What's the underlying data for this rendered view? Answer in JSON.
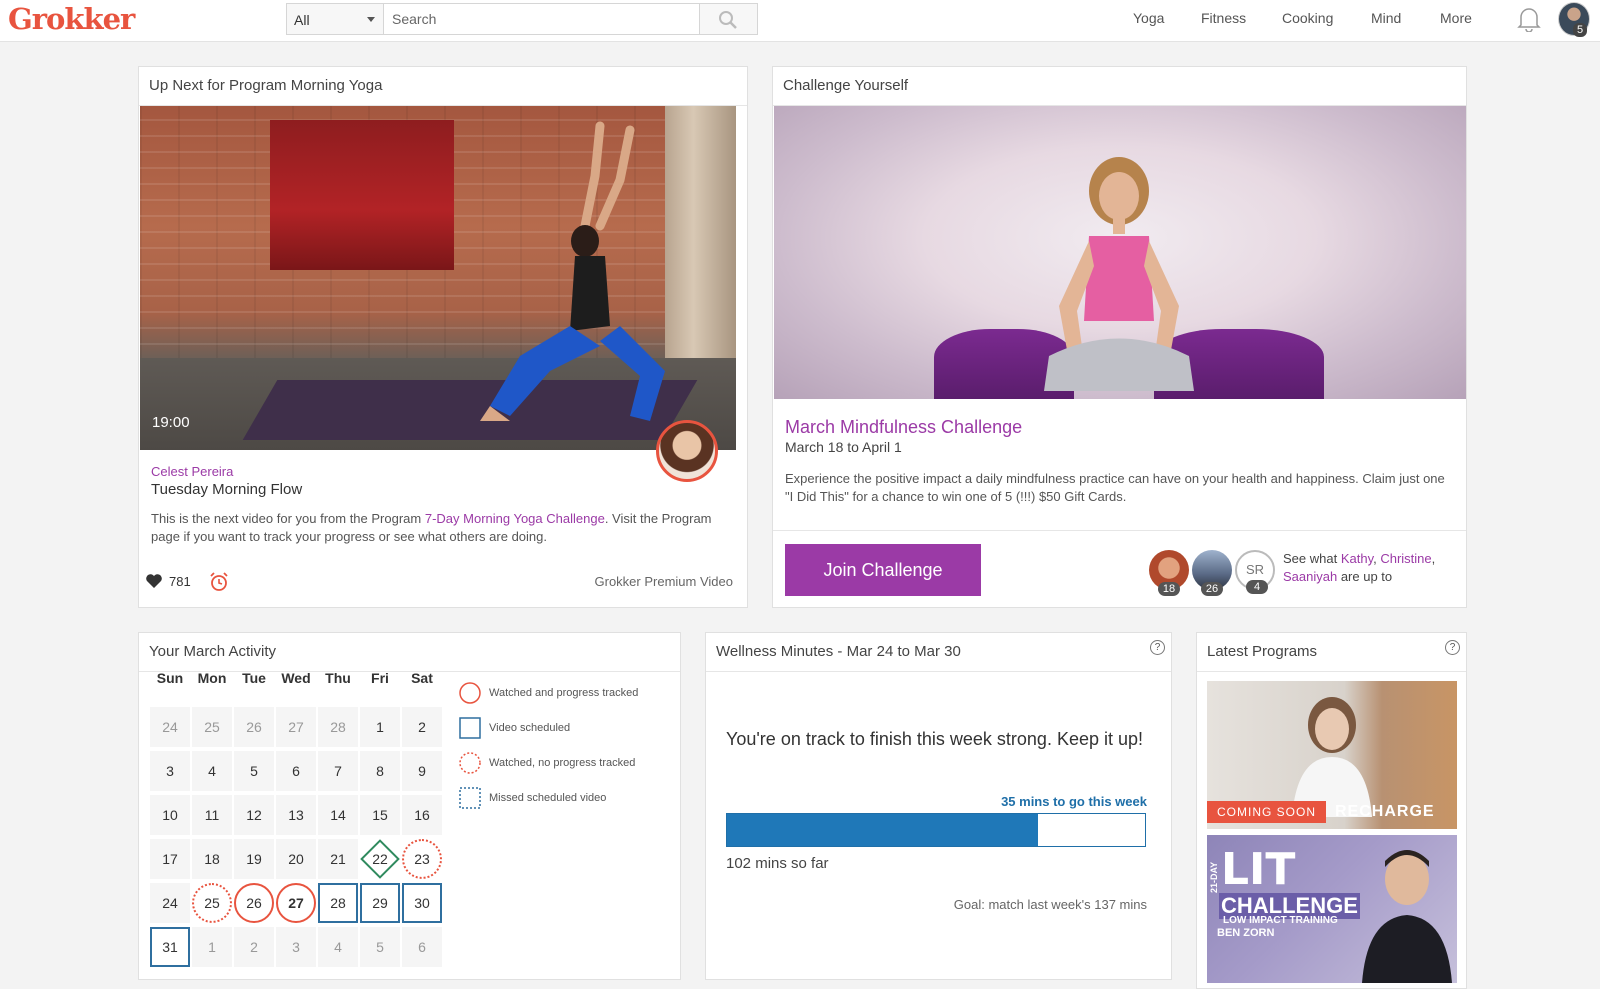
{
  "header": {
    "logo": "Grokker",
    "search_scope": "All",
    "search_placeholder": "Search",
    "nav": [
      "Yoga",
      "Fitness",
      "Cooking",
      "Mind",
      "More"
    ],
    "notification_count": "5"
  },
  "up_next": {
    "title": "Up Next for Program Morning Yoga",
    "duration": "19:00",
    "instructor": "Celest Pereira",
    "video_title": "Tuesday Morning Flow",
    "desc_before": "This is the next video for you from the Program ",
    "desc_link": "7-Day Morning Yoga Challenge",
    "desc_after": ". Visit the Program page if you want to track your progress or see what others are doing.",
    "likes": "781",
    "badge": "Grokker Premium Video"
  },
  "challenge": {
    "title": "Challenge Yourself",
    "name": "March Mindfulness Challenge",
    "dates": "March 18 to April 1",
    "description": "Experience the positive impact a daily mindfulness practice can have on your health and happiness. Claim just one \"I Did This\" for a chance to win one of 5 (!!!) $50 Gift Cards.",
    "join_label": "Join Challenge",
    "friends": [
      {
        "count": "18"
      },
      {
        "count": "26"
      },
      {
        "initials": "SR",
        "count": "4"
      }
    ],
    "see_what": "See what ",
    "friend_names": [
      "Kathy",
      "Christine",
      "Saaniyah"
    ],
    "are_up_to": " are up to",
    "comma": ", "
  },
  "activity": {
    "title": "Your March Activity",
    "days": [
      "Sun",
      "Mon",
      "Tue",
      "Wed",
      "Thu",
      "Fri",
      "Sat"
    ],
    "weeks": [
      [
        {
          "d": "24",
          "s": "other"
        },
        {
          "d": "25",
          "s": "other"
        },
        {
          "d": "26",
          "s": "other"
        },
        {
          "d": "27",
          "s": "other"
        },
        {
          "d": "28",
          "s": "other"
        },
        {
          "d": "1",
          "s": ""
        },
        {
          "d": "2",
          "s": ""
        }
      ],
      [
        {
          "d": "3",
          "s": ""
        },
        {
          "d": "4",
          "s": ""
        },
        {
          "d": "5",
          "s": ""
        },
        {
          "d": "6",
          "s": ""
        },
        {
          "d": "7",
          "s": ""
        },
        {
          "d": "8",
          "s": ""
        },
        {
          "d": "9",
          "s": ""
        }
      ],
      [
        {
          "d": "10",
          "s": ""
        },
        {
          "d": "11",
          "s": ""
        },
        {
          "d": "12",
          "s": ""
        },
        {
          "d": "13",
          "s": ""
        },
        {
          "d": "14",
          "s": ""
        },
        {
          "d": "15",
          "s": ""
        },
        {
          "d": "16",
          "s": ""
        }
      ],
      [
        {
          "d": "17",
          "s": ""
        },
        {
          "d": "18",
          "s": ""
        },
        {
          "d": "19",
          "s": ""
        },
        {
          "d": "20",
          "s": ""
        },
        {
          "d": "21",
          "s": ""
        },
        {
          "d": "22",
          "s": "diamond"
        },
        {
          "d": "23",
          "s": "dotted"
        }
      ],
      [
        {
          "d": "24",
          "s": ""
        },
        {
          "d": "25",
          "s": "dotted"
        },
        {
          "d": "26",
          "s": "watched"
        },
        {
          "d": "27",
          "s": "watched today"
        },
        {
          "d": "28",
          "s": "scheduled"
        },
        {
          "d": "29",
          "s": "scheduled"
        },
        {
          "d": "30",
          "s": "scheduled"
        }
      ],
      [
        {
          "d": "31",
          "s": "scheduled"
        },
        {
          "d": "1",
          "s": "other"
        },
        {
          "d": "2",
          "s": "other"
        },
        {
          "d": "3",
          "s": "other"
        },
        {
          "d": "4",
          "s": "other"
        },
        {
          "d": "5",
          "s": "other"
        },
        {
          "d": "6",
          "s": "other"
        }
      ]
    ],
    "legend": [
      "Watched and progress tracked",
      "Video scheduled",
      "Watched, no progress tracked",
      "Missed scheduled video"
    ]
  },
  "wellness": {
    "title": "Wellness Minutes - Mar 24 to Mar 30",
    "message": "You're on track to finish this week strong. Keep it up!",
    "to_go": "35 mins to go this week",
    "progress_fraction": 0.745,
    "so_far": "102 mins so far",
    "goal": "Goal: match last week's 137 mins"
  },
  "latest": {
    "title": "Latest Programs",
    "program1_badge": "COMING SOON",
    "program1_title": "RECHARGE",
    "program2_day": "21-DAY",
    "program2_title": "LIT",
    "program2_sub": "CHALLENGE",
    "program2_sub2": "LOW IMPACT TRAINING",
    "program2_author": "BEN ZORN"
  },
  "colors": {
    "brand": "#e8543f",
    "purple": "#9b3aa6",
    "blue": "#1f78b8"
  }
}
